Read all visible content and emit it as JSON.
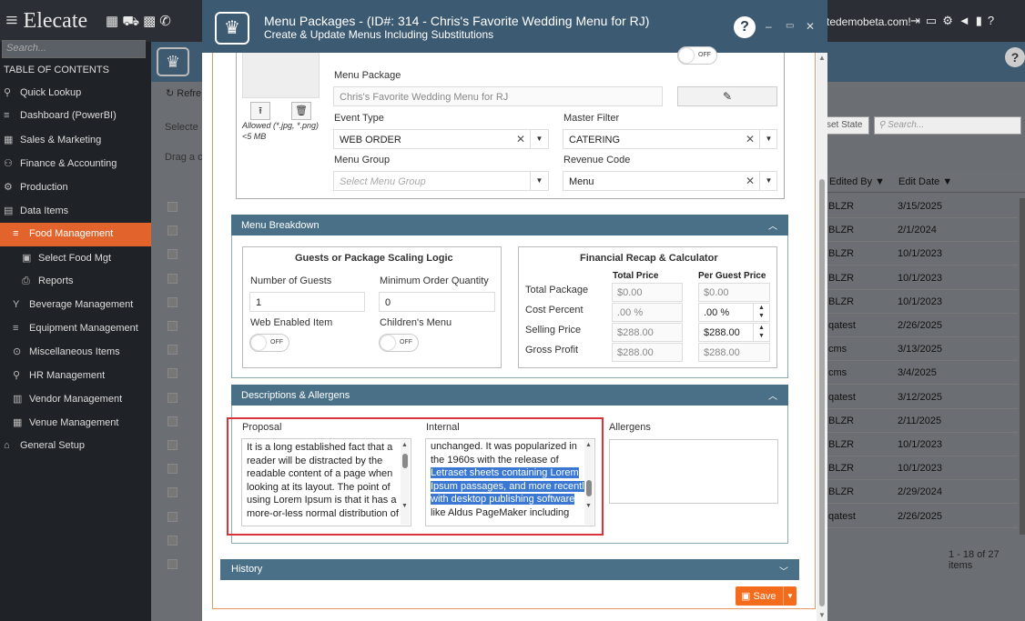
{
  "app": {
    "logo": "Elecate",
    "user_email": "tedemobeta.com!"
  },
  "sidebar": {
    "search_placeholder": "Search...",
    "toc_title": "TABLE OF CONTENTS",
    "items": [
      {
        "label": "Quick Lookup",
        "icon": "search-icon",
        "glyph": "⚲"
      },
      {
        "label": "Dashboard (PowerBI)",
        "icon": "dashboard-icon",
        "glyph": "≡"
      },
      {
        "label": "Sales & Marketing",
        "icon": "sales-icon",
        "glyph": "▦"
      },
      {
        "label": "Finance & Accounting",
        "icon": "finance-icon",
        "glyph": "⚇"
      },
      {
        "label": "Production",
        "icon": "production-icon",
        "glyph": "⚙"
      },
      {
        "label": "Data Items",
        "icon": "data-icon",
        "glyph": "▤"
      },
      {
        "label": "Food Management",
        "icon": "food-icon",
        "glyph": "≡"
      },
      {
        "label": "Select Food Mgt",
        "icon": "select-icon",
        "glyph": "▣"
      },
      {
        "label": "Reports",
        "icon": "print-icon",
        "glyph": "⎙"
      },
      {
        "label": "Beverage Management",
        "icon": "beverage-icon",
        "glyph": "Y"
      },
      {
        "label": "Equipment Management",
        "icon": "equipment-icon",
        "glyph": "≡"
      },
      {
        "label": "Miscellaneous Items",
        "icon": "misc-icon",
        "glyph": "⊙"
      },
      {
        "label": "HR Management",
        "icon": "hr-icon",
        "glyph": "⚲"
      },
      {
        "label": "Vendor Management",
        "icon": "vendor-icon",
        "glyph": "▥"
      },
      {
        "label": "Venue Management",
        "icon": "venue-icon",
        "glyph": "▦"
      },
      {
        "label": "General Setup",
        "icon": "setup-icon",
        "glyph": "⌂"
      }
    ]
  },
  "background": {
    "refresh_label": "Refre",
    "selected_label": "Selecte",
    "drag_label": "Drag a co",
    "reset_state": "set State",
    "search_placeholder": "Search...",
    "col_edited_by": "Edited By",
    "col_edit_date": "Edit Date",
    "rows": [
      {
        "by": "BLZR",
        "date": "3/15/2025"
      },
      {
        "by": "BLZR",
        "date": "2/1/2024"
      },
      {
        "by": "BLZR",
        "date": "10/1/2023"
      },
      {
        "by": "BLZR",
        "date": "10/1/2023"
      },
      {
        "by": "BLZR",
        "date": "10/1/2023"
      },
      {
        "by": "qatest",
        "date": "2/26/2025"
      },
      {
        "by": "cms",
        "date": "3/13/2025"
      },
      {
        "by": "cms",
        "date": "3/4/2025"
      },
      {
        "by": "qatest",
        "date": "3/12/2025"
      },
      {
        "by": "BLZR",
        "date": "2/11/2025"
      },
      {
        "by": "BLZR",
        "date": "10/1/2023"
      },
      {
        "by": "BLZR",
        "date": "10/1/2023"
      },
      {
        "by": "BLZR",
        "date": "2/29/2024"
      },
      {
        "by": "qatest",
        "date": "2/26/2025"
      }
    ],
    "pager": "1 - 18 of 27 items"
  },
  "modal": {
    "title": "Menu Packages - (ID#: 314 - Chris's Favorite Wedding Menu for RJ)",
    "subtitle": "Create & Update Menus Including Substitutions",
    "allowed_text": "Allowed (*.jpg, *.png) <5 MB",
    "toggle_off": "OFF",
    "menu_package_label": "Menu Package",
    "menu_package_value": "Chris's Favorite Wedding Menu for RJ",
    "event_type_label": "Event Type",
    "event_type_value": "WEB ORDER",
    "master_filter_label": "Master Filter",
    "master_filter_value": "CATERING",
    "menu_group_label": "Menu Group",
    "menu_group_placeholder": "Select Menu Group",
    "revenue_code_label": "Revenue Code",
    "revenue_code_value": "Menu",
    "breakdown": {
      "title": "Menu Breakdown",
      "guests_title": "Guests or Package Scaling Logic",
      "num_guests_label": "Number of Guests",
      "num_guests_value": "1",
      "min_order_label": "Minimum Order Quantity",
      "min_order_value": "0",
      "web_enabled_label": "Web Enabled Item",
      "childrens_menu_label": "Children's Menu",
      "recap_title": "Financial Recap & Calculator",
      "col_total": "Total Price",
      "col_per_guest": "Per Guest Price",
      "rows": [
        {
          "label": "Total Package",
          "total": "$0.00",
          "per_guest": "$0.00"
        },
        {
          "label": "Cost Percent",
          "total": ".00 %",
          "per_guest": ".00 %"
        },
        {
          "label": "Selling Price",
          "total": "$288.00",
          "per_guest": "$288.00"
        },
        {
          "label": "Gross Profit",
          "total": "$288.00",
          "per_guest": "$288.00"
        }
      ]
    },
    "descriptions": {
      "title": "Descriptions & Allergens",
      "proposal_label": "Proposal",
      "proposal_lines": [
        "It is a long established fact that a",
        "reader will be distracted by the",
        "readable content of a page when",
        "looking at its layout. The point of",
        "using Lorem Ipsum is that it has a",
        "more-or-less normal distribution of"
      ],
      "internal_label": "Internal",
      "internal_lines": [
        "unchanged. It was popularized in",
        "the 1960s with the release of"
      ],
      "internal_highlight": [
        "Letraset sheets containing Lorem",
        "Ipsum passages, and more recently",
        "with desktop publishing software"
      ],
      "internal_after": [
        "like Aldus PageMaker including"
      ],
      "allergens_label": "Allergens"
    },
    "history_title": "History",
    "save_label": "Save"
  }
}
